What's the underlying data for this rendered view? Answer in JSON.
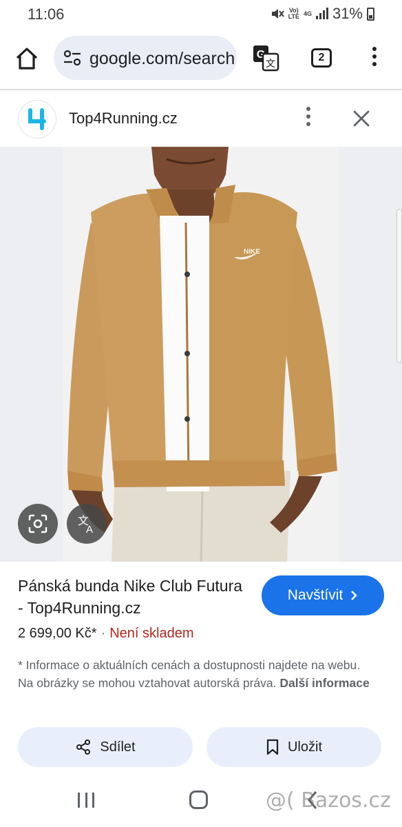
{
  "status_bar": {
    "time": "11:06",
    "volte": "Vo)\nLTE",
    "network": "4G",
    "battery": "31%"
  },
  "browser": {
    "url": "google.com/search",
    "tab_count": "2"
  },
  "source": {
    "site_name": "Top4Running.cz",
    "logo_glyph": "4"
  },
  "product": {
    "title": "Pánská bunda Nike Club Futura - Top4Running.cz",
    "visit_label": "Navštívit",
    "price": "2 699,00 Kč*",
    "separator": "·",
    "stock_status": "Není skladem",
    "disclaimer": "* Informace o aktuálních cenách a dostupnosti najdete na webu. Na obrázky se mohou vztahovat autorská práva.",
    "more_info": "Další informace",
    "brand_mark": "NIKE"
  },
  "actions": {
    "share_label": "Sdílet",
    "save_label": "Uložit"
  },
  "watermark": "@( Bazos.cz",
  "colors": {
    "accent": "#1a73e8",
    "stock": "#b3261e",
    "jacket": "#c99a5b"
  }
}
